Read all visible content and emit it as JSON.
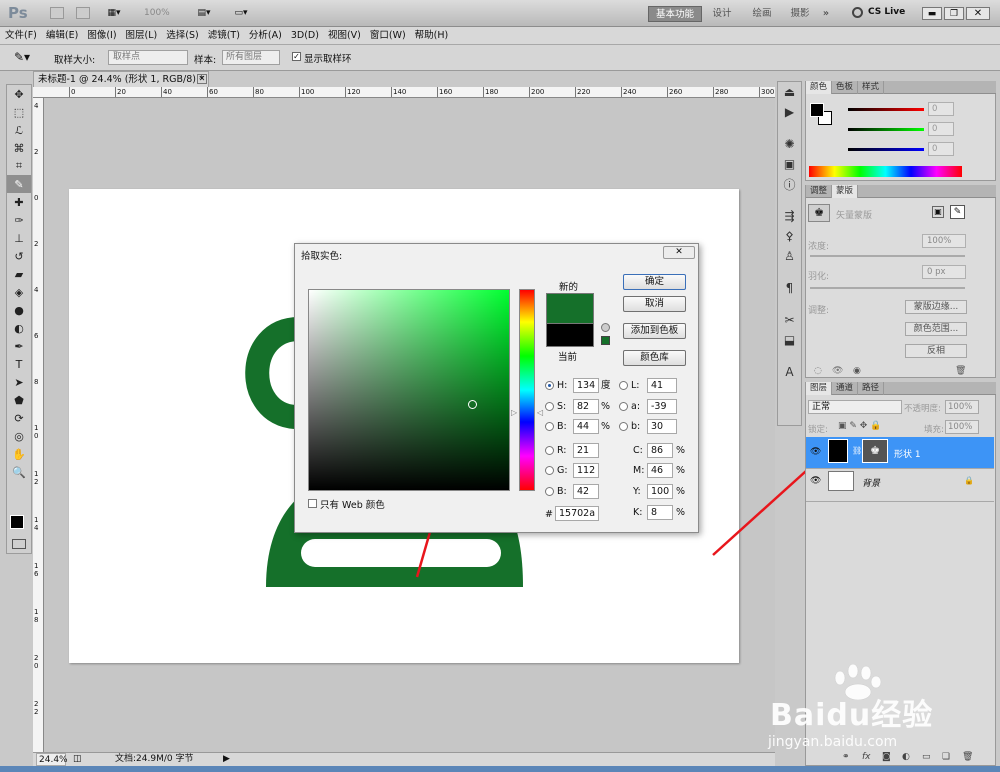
{
  "app": {
    "logo": "Ps",
    "zoom": "100%",
    "workspaces": [
      "基本功能",
      "设计",
      "绘画",
      "摄影"
    ],
    "more": "»",
    "cs_live": "CS Live"
  },
  "menu": [
    "文件(F)",
    "编辑(E)",
    "图像(I)",
    "图层(L)",
    "选择(S)",
    "滤镜(T)",
    "分析(A)",
    "3D(D)",
    "视图(V)",
    "窗口(W)",
    "帮助(H)"
  ],
  "options": {
    "sample_size_label": "取样大小:",
    "sample_size_value": "取样点",
    "sample_label": "样本:",
    "sample_value": "所有图层",
    "show_ring_label": "显示取样环"
  },
  "document": {
    "tab_title": "未标题-1 @ 24.4% (形状 1, RGB/8) *",
    "ruler_ticks": [
      "0",
      "20",
      "40",
      "60",
      "80",
      "100",
      "120",
      "140",
      "160",
      "180",
      "200",
      "220",
      "240",
      "260",
      "280",
      "300"
    ],
    "vruler_ticks": [
      "4",
      "2",
      "0",
      "2",
      "4",
      "6",
      "8",
      "1 0",
      "1 2",
      "1 4",
      "1 6",
      "1 8",
      "2 0",
      "2 2"
    ],
    "zoom": "24.4%",
    "doc_info": "文档:24.9M/0 字节",
    "shape_color": "#15702a"
  },
  "color_picker": {
    "title": "拾取实色:",
    "new_label": "新的",
    "current_label": "当前",
    "new_color": "#15702a",
    "current_color": "#000000",
    "ok": "确定",
    "cancel": "取消",
    "add_swatch": "添加到色板",
    "libraries": "颜色库",
    "web_only": "只有 Web 颜色",
    "H": "134",
    "S": "82",
    "B": "44",
    "R": "21",
    "G": "112",
    "Bv": "42",
    "L": "41",
    "a": "-39",
    "b": "30",
    "C": "86",
    "M": "46",
    "Y": "100",
    "K": "8",
    "hex": "15702a",
    "unit_degree": "度",
    "unit_percent": "%",
    "labels": {
      "H": "H:",
      "S": "S:",
      "B": "B:",
      "R": "R:",
      "G": "G:",
      "Bv": "B:",
      "L": "L:",
      "a": "a:",
      "b": "b:",
      "C": "C:",
      "M": "M:",
      "Y": "Y:",
      "K": "K:",
      "hash": "#"
    }
  },
  "panels": {
    "color_tabs": [
      "颜色",
      "色板",
      "样式"
    ],
    "rgb_values": [
      "0",
      "0",
      "0"
    ],
    "adjust_tabs": [
      "调整",
      "蒙版"
    ],
    "mask_title": "矢量蒙版",
    "density_label": "浓度:",
    "density_value": "100%",
    "feather_label": "羽化:",
    "feather_value": "0 px",
    "refine_label": "调整:",
    "mask_edge": "蒙版边缘...",
    "color_range": "颜色范围...",
    "invert": "反相",
    "layer_tabs": [
      "图层",
      "通道",
      "路径"
    ],
    "blend_mode": "正常",
    "opacity_label": "不透明度:",
    "opacity_value": "100%",
    "lock_label": "锁定:",
    "fill_label": "填充:",
    "fill_value": "100%",
    "layers": [
      "形状 1",
      "背景"
    ]
  },
  "watermark": {
    "brand": "Baidu经验",
    "url": "jingyan.baidu.com"
  }
}
